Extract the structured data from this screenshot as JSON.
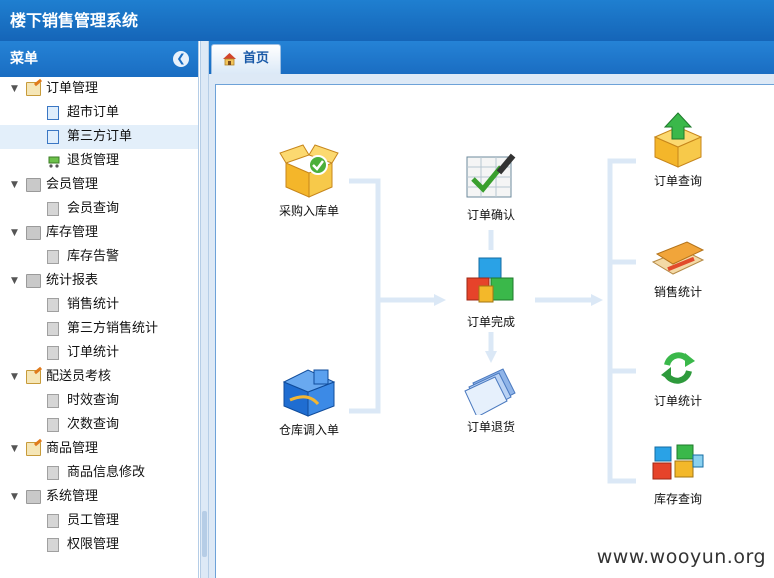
{
  "app": {
    "title": "楼下销售管理系统"
  },
  "sidebar": {
    "title": "菜单",
    "collapse_glyph": "❮",
    "groups": [
      {
        "label": "订单管理",
        "icon": "folder-edit-icon",
        "items": [
          {
            "label": "超市订单",
            "icon": "page-icon"
          },
          {
            "label": "第三方订单",
            "icon": "page-icon",
            "selected": true
          },
          {
            "label": "退货管理",
            "icon": "cart-icon"
          }
        ]
      },
      {
        "label": "会员管理",
        "icon": "folder-icon",
        "items": [
          {
            "label": "会员查询",
            "icon": "page-icon"
          }
        ]
      },
      {
        "label": "库存管理",
        "icon": "folder-icon",
        "items": [
          {
            "label": "库存告警",
            "icon": "page-icon"
          }
        ]
      },
      {
        "label": "统计报表",
        "icon": "folder-icon",
        "items": [
          {
            "label": "销售统计",
            "icon": "page-icon"
          },
          {
            "label": "第三方销售统计",
            "icon": "page-icon"
          },
          {
            "label": "订单统计",
            "icon": "page-icon"
          }
        ]
      },
      {
        "label": "配送员考核",
        "icon": "folder-edit-icon",
        "items": [
          {
            "label": "时效查询",
            "icon": "page-icon"
          },
          {
            "label": "次数查询",
            "icon": "page-icon"
          }
        ]
      },
      {
        "label": "商品管理",
        "icon": "folder-edit-icon",
        "items": [
          {
            "label": "商品信息修改",
            "icon": "page-icon"
          }
        ]
      },
      {
        "label": "系统管理",
        "icon": "folder-icon",
        "items": [
          {
            "label": "员工管理",
            "icon": "page-icon"
          },
          {
            "label": "权限管理",
            "icon": "page-icon"
          }
        ]
      }
    ]
  },
  "tabs": [
    {
      "label": "首页",
      "icon": "home-icon"
    }
  ],
  "flow": {
    "purchase_in": "采购入库单",
    "warehouse_transfer": "仓库调入单",
    "order_confirm": "订单确认",
    "order_complete": "订单完成",
    "order_return": "订单退货",
    "order_query": "订单查询",
    "sales_stats": "销售统计",
    "order_stats": "订单统计",
    "stock_query": "库存查询"
  },
  "watermark": "www.wooyun.org",
  "colors": {
    "header": "#1a6dc2",
    "connector": "#dbe8f6",
    "selected_row": "#e3effa"
  }
}
